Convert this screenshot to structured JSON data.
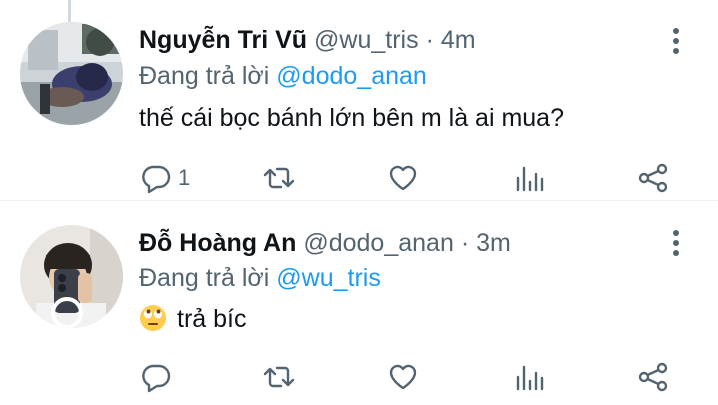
{
  "tweets": [
    {
      "name": "Nguyễn Tri Vũ",
      "handle": "@wu_tris",
      "separator": "·",
      "time": "4m",
      "reply_prefix": "Đang trả lời",
      "reply_mention": "@dodo_anan",
      "text": "thế cái bọc bánh lớn bên m là ai mua?",
      "emoji": "",
      "reply_count": "1",
      "avatar_icon": "person-with-hoodie-avatar"
    },
    {
      "name": "Đỗ Hoàng An",
      "handle": "@dodo_anan",
      "separator": "·",
      "time": "3m",
      "reply_prefix": "Đang trả lời",
      "reply_mention": "@wu_tris",
      "text": "trả bíc",
      "emoji": "face-with-rolling-eyes",
      "reply_count": "",
      "avatar_icon": "mirror-selfie-avatar"
    }
  ],
  "colors": {
    "text": "#0f1419",
    "secondary": "#536471",
    "accent": "#1d9bf0",
    "thread_line": "#cfd9de"
  }
}
